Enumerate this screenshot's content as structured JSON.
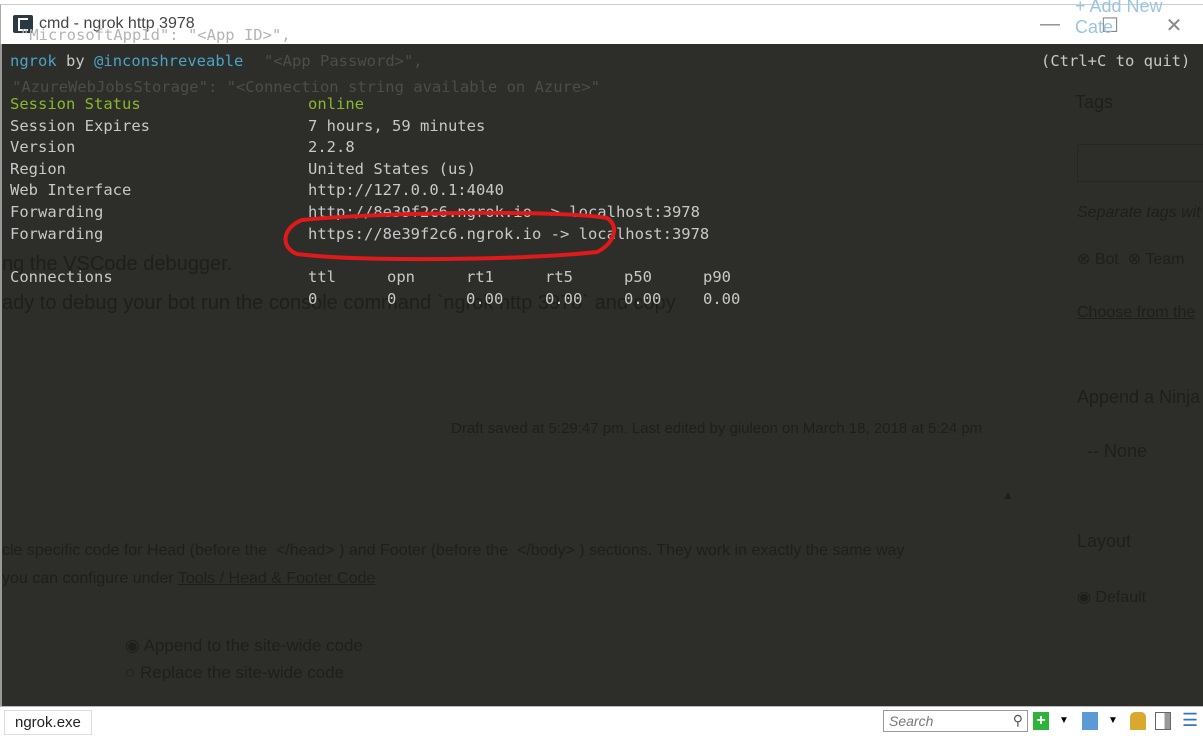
{
  "window": {
    "title": "cmd - ngrok  http 3978",
    "minimize": "—",
    "maximize": "☐",
    "close": "✕"
  },
  "terminal": {
    "brand": "ngrok",
    "by": "by",
    "author": "@inconshreveable",
    "quit_hint": "(Ctrl+C to quit)",
    "rows": [
      {
        "label": "Session Status",
        "value": "online"
      },
      {
        "label": "Session Expires",
        "value": "7 hours, 59 minutes"
      },
      {
        "label": "Version",
        "value": "2.2.8"
      },
      {
        "label": "Region",
        "value": "United States (us)"
      },
      {
        "label": "Web Interface",
        "value": "http://127.0.0.1:4040"
      },
      {
        "label": "Forwarding",
        "value": "http://8e39f2c6.ngrok.io -> localhost:3978"
      },
      {
        "label": "Forwarding",
        "value": "https://8e39f2c6.ngrok.io -> localhost:3978"
      }
    ],
    "connections": {
      "label": "Connections",
      "headers": [
        "ttl",
        "opn",
        "rt1",
        "rt5",
        "p50",
        "p90"
      ],
      "values": [
        "0",
        "0",
        "0.00",
        "0.00",
        "0.00",
        "0.00"
      ]
    },
    "highlight_color": "#e0191b"
  },
  "background_page": {
    "code": [
      "\"MicrosoftAppId\": \"<App ID>\",",
      "\"<App Password>\",",
      "\"AzureWebJobsStorage\": \"<Connection string available on Azure>\""
    ],
    "text1": "ng the VSCode debugger.",
    "text2": "ady to debug your bot run the console command `ngrok http 3978` and copy",
    "add_category": "+ Add New Cate",
    "tags": "Tags",
    "tags_hint": "Separate tags wit",
    "tag1": "Bot",
    "tag2": "Team",
    "choose": "Choose from the",
    "append": "Append a Ninja",
    "none": "-- None",
    "draft": "Draft saved at 5:29:47 pm. Last edited by giuleon on March 18, 2018 at 5:24 pm",
    "head_text": "cle specific code for Head (before the  </head> ) and Footer (before the  </body> ) sections. They work in exactly the same way",
    "head_text2": "you can configure under ",
    "head_link": "Tools / Head & Footer Code",
    "layout": "Layout",
    "default": "Default",
    "radio1": "Append to the site-wide code",
    "radio2": "Replace the site-wide code"
  },
  "statusbar": {
    "tab": "ngrok.exe",
    "search_placeholder": "Search"
  }
}
